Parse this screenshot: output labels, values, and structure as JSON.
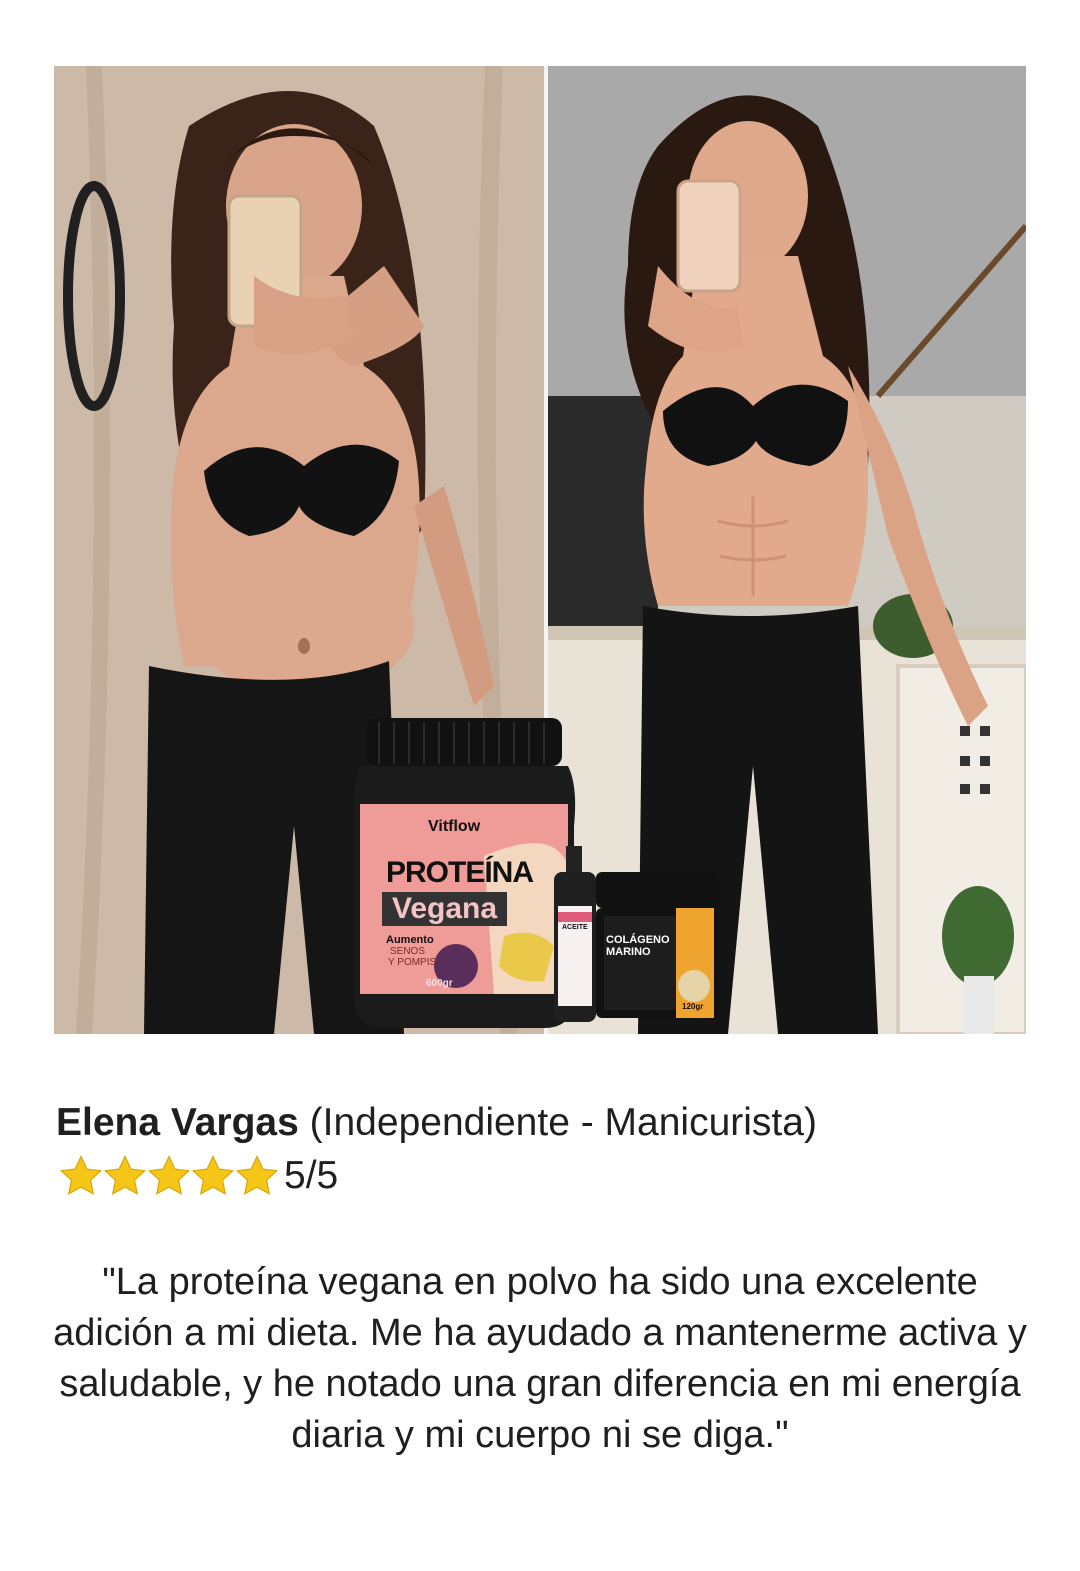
{
  "review": {
    "reviewer_name": "Elena Vargas",
    "reviewer_role": "(Independiente - Manicurista)",
    "rating": 5,
    "rating_max": 5,
    "rating_text": "5/5",
    "quote": "\"La proteína vegana en polvo ha sido una excelente adición a mi dieta. Me ha ayudado a mantenerme activa y saludable, y he notado una gran diferencia en mi energía diaria y mi cuerpo ni se diga.\""
  },
  "products": {
    "jar_brand": "Vitflow",
    "jar_title_1": "PROTEÍNA",
    "jar_title_2": "Vegana",
    "jar_subtitle_1": "Aumento",
    "jar_subtitle_2": "SENOS",
    "jar_subtitle_3": "Y POMPIS",
    "jar_weight": "600gr",
    "bottle_label": "ACEITE",
    "collagen_title_1": "COLÁGENO",
    "collagen_title_2": "MARINO",
    "collagen_weight": "120gr"
  },
  "icons": {
    "star": "star-icon",
    "phone": "phone-icon"
  },
  "colors": {
    "star": "#f5c518",
    "star_stroke": "#d9a400",
    "jar_pink": "#ef8f8f",
    "jar_dark": "#1b1b1b",
    "collagen_orange": "#f0a430"
  }
}
